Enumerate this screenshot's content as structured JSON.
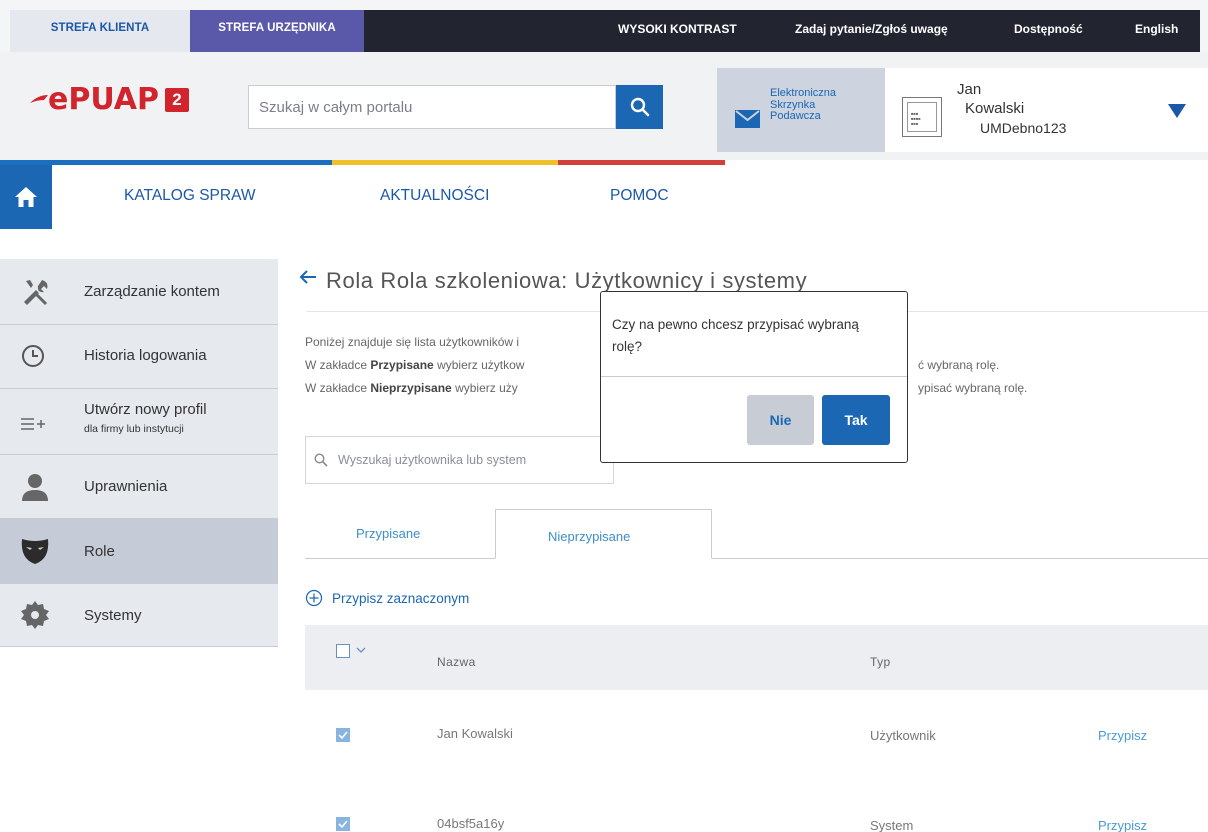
{
  "topbar": {
    "zone_client": "STREFA KLIENTA",
    "zone_official": "STREFA URZĘDNIKA",
    "high_contrast": "WYSOKI KONTRAST",
    "ask_question": "Zadaj pytanie/Zgłoś uwagę",
    "accessibility": "Dostępność",
    "language": "English"
  },
  "header": {
    "logo_text": "ePUAP",
    "logo_number": "2",
    "search_placeholder": "Szukaj w całym portalu",
    "esp": {
      "line1": "Elektroniczna",
      "line2": "Skrzynka",
      "line3": "Podawcza"
    },
    "user": {
      "first_name": "Jan",
      "last_name": "Kowalski",
      "login": "UMDebno123"
    }
  },
  "colors": {
    "brand_red": "#d1242c",
    "brand_blue": "#1b67b4",
    "bar_blue": "#1b6fc0",
    "bar_yellow": "#f1bf2a",
    "bar_red": "#d33f3a"
  },
  "nav": {
    "items": [
      "KATALOG SPRAW",
      "AKTUALNOŚCI",
      "POMOC"
    ]
  },
  "sidebar": {
    "items": [
      {
        "label": "Zarządzanie kontem",
        "icon": "tools-icon"
      },
      {
        "label": "Historia logowania",
        "icon": "clock-icon"
      },
      {
        "label": "Utwórz nowy profil",
        "sub": "dla firmy lub instytucji",
        "icon": "add-list-icon"
      },
      {
        "label": "Uprawnienia",
        "icon": "person-icon"
      },
      {
        "label": "Role",
        "icon": "mask-icon"
      },
      {
        "label": "Systemy",
        "icon": "gear-icon"
      }
    ]
  },
  "main": {
    "title": "Rola Rola szkoleniowa: Użytkownicy i systemy",
    "desc": {
      "line1_prefix": "Poniżej znajduje się lista użytkowników i",
      "line2_pre": "W zakładce ",
      "line2_bold": "Przypisane",
      "line2_mid": " wybierz użytkow",
      "line2_end": "ć wybraną rolę.",
      "line3_pre": "W zakładce ",
      "line3_bold": "Nieprzypisane",
      "line3_mid": " wybierz uży",
      "line3_end": "ypisać wybraną rolę."
    },
    "user_search_placeholder": "Wyszukaj użytkownika lub system",
    "tabs": [
      "Przypisane",
      "Nieprzypisane"
    ],
    "assign_selected": "Przypisz zaznaczonym",
    "table": {
      "headers": {
        "name": "Nazwa",
        "type": "Typ"
      },
      "rows": [
        {
          "name": "Jan Kowalski",
          "type": "Użytkownik",
          "action": "Przypisz"
        },
        {
          "name": "04bsf5a16y",
          "type": "System",
          "action": "Przypisz"
        }
      ]
    }
  },
  "modal": {
    "message": "Czy na pewno chcesz przypisać wybraną rolę?",
    "no_label": "Nie",
    "yes_label": "Tak"
  }
}
